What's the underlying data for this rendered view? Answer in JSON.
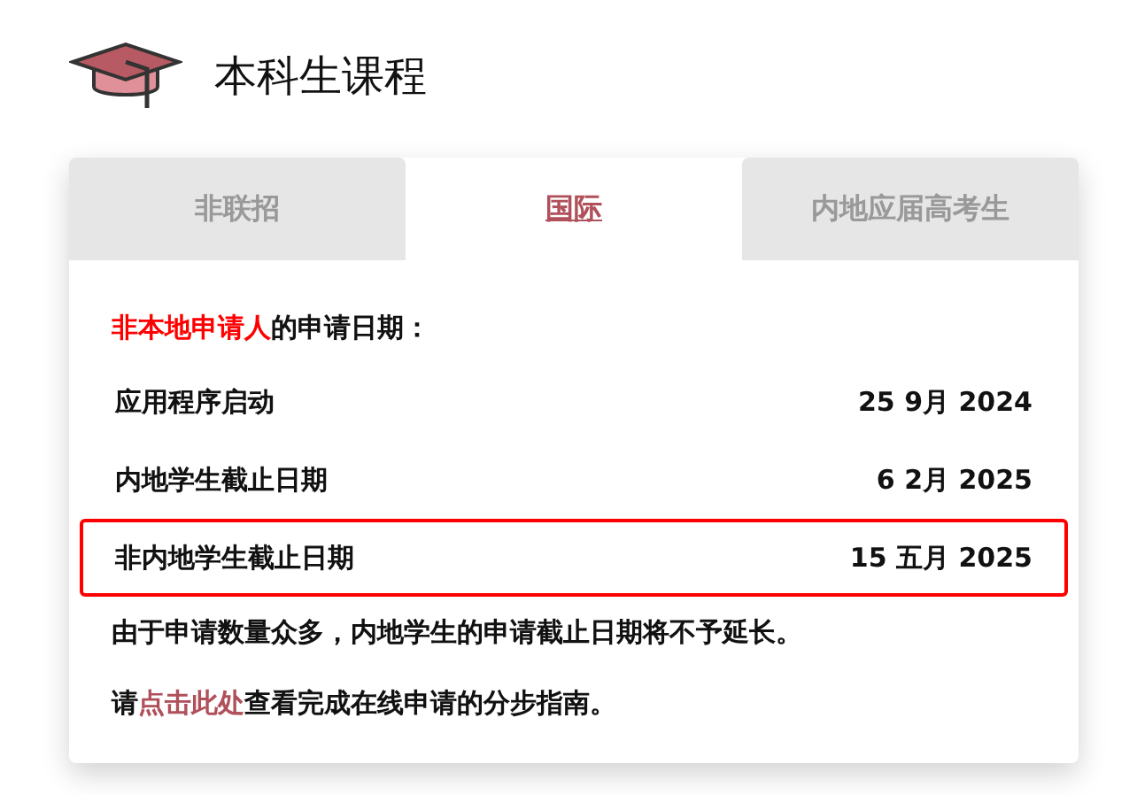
{
  "header": {
    "title": "本科生课程"
  },
  "tabs": [
    {
      "label": "非联招",
      "selected": false
    },
    {
      "label": "国际",
      "selected": true
    },
    {
      "label": "内地应届高考生",
      "selected": false
    }
  ],
  "heading": {
    "highlight": "非本地申请人",
    "rest": "的申请日期："
  },
  "dates": [
    {
      "label": "应用程序启动",
      "date": "25 9月 2024",
      "highlighted": false
    },
    {
      "label": "内地学生截止日期",
      "date": "6 2月 2025",
      "highlighted": false
    },
    {
      "label": "非内地学生截止日期",
      "date": "15 五月 2025",
      "highlighted": true
    }
  ],
  "notice": "由于申请数量众多，内地学生的申请截止日期将不予延长。",
  "guide": {
    "prefix": "请",
    "link": "点击此处",
    "suffix": "查看完成在线申请的分步指南。"
  }
}
